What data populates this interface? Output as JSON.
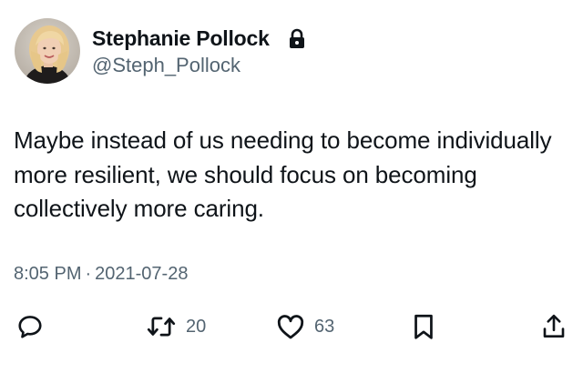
{
  "author": {
    "name": "Stephanie Pollock",
    "handle": "@Steph_Pollock",
    "protected_icon": "lock-icon",
    "avatar_icon": "avatar-photo"
  },
  "tweet": {
    "text": "Maybe instead of us needing to become individually more resilient, we should focus on becoming collectively more caring.",
    "time": "8:05 PM",
    "separator": "·",
    "date": "2021-07-28"
  },
  "actions": {
    "reply": {
      "icon": "reply-icon",
      "count": ""
    },
    "retweet": {
      "icon": "retweet-icon",
      "count": "20"
    },
    "like": {
      "icon": "heart-icon",
      "count": "63"
    },
    "bookmark": {
      "icon": "bookmark-icon",
      "count": ""
    },
    "share": {
      "icon": "share-icon",
      "count": ""
    }
  },
  "colors": {
    "text_primary": "#0f1419",
    "text_secondary": "#536471",
    "background": "#ffffff"
  }
}
